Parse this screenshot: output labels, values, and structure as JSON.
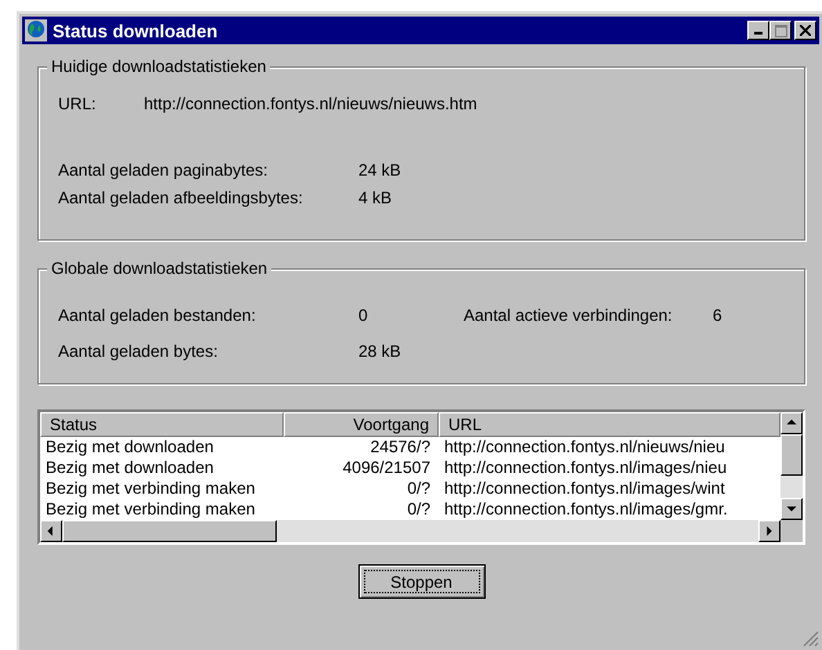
{
  "window": {
    "title": "Status downloaden"
  },
  "current": {
    "title": "Huidige downloadstatistieken",
    "url_label": "URL:",
    "url": "http://connection.fontys.nl/nieuws/nieuws.htm",
    "stats": [
      {
        "label": "Aantal geladen paginabytes:",
        "value": "24 kB"
      },
      {
        "label": "Aantal geladen afbeeldingsbytes:",
        "value": "4 kB"
      }
    ]
  },
  "global": {
    "title": "Globale downloadstatistieken",
    "stats": [
      {
        "label": "Aantal geladen bestanden:",
        "value": "0"
      },
      {
        "label": "Aantal geladen bytes:",
        "value": "28 kB"
      }
    ],
    "connections": {
      "label": "Aantal actieve verbindingen:",
      "value": "6"
    }
  },
  "table": {
    "columns": [
      "Status",
      "Voortgang",
      "URL"
    ],
    "rows": [
      [
        "Bezig met downloaden",
        "24576/?",
        "http://connection.fontys.nl/nieuws/nieu"
      ],
      [
        "Bezig met downloaden",
        "4096/21507",
        "http://connection.fontys.nl/images/nieu"
      ],
      [
        "Bezig met verbinding maken",
        "0/?",
        "http://connection.fontys.nl/images/wint"
      ],
      [
        "Bezig met verbinding maken",
        "0/?",
        "http://connection.fontys.nl/images/gmr."
      ]
    ]
  },
  "buttons": [
    "Stoppen"
  ]
}
